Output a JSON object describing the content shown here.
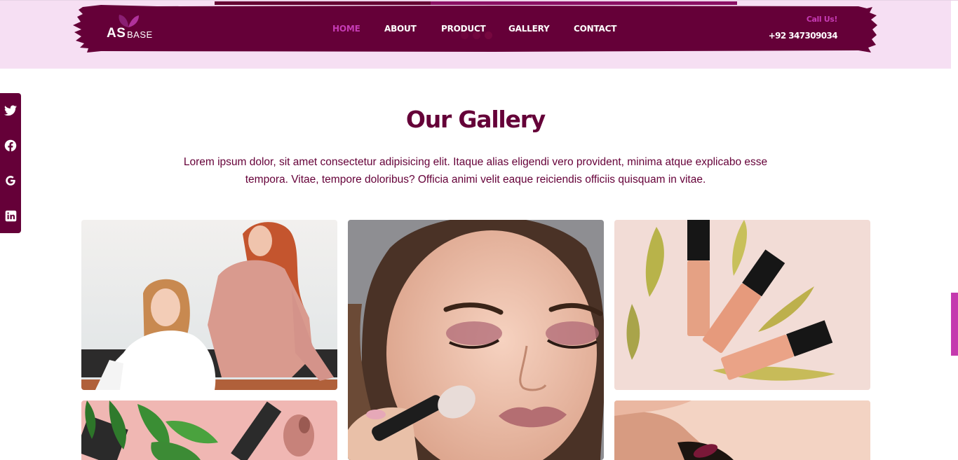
{
  "header": {
    "logo": {
      "primary": "AS",
      "secondary": "BASE"
    },
    "nav": [
      {
        "label": "HOME",
        "active": true
      },
      {
        "label": "ABOUT",
        "active": false
      },
      {
        "label": "PRODUCT",
        "active": false
      },
      {
        "label": "GALLERY",
        "active": false
      },
      {
        "label": "CONTACT",
        "active": false
      }
    ],
    "call_label": "Call Us!",
    "phone": "+92 347309034"
  },
  "social": [
    {
      "icon": "twitter-icon"
    },
    {
      "icon": "facebook-icon"
    },
    {
      "icon": "google-icon"
    },
    {
      "icon": "linkedin-icon"
    }
  ],
  "gallery": {
    "title": "Our Gallery",
    "description": "Lorem ipsum dolor, sit amet consectetur adipisicing elit. Itaque alias eligendi vero provident, minima atque explicabo esse tempora. Vitae, tempore doloribus? Officia animi velit eaque reiciendis officiis quisquam in vitae.",
    "images": [
      {
        "subject": "two-women-photo"
      },
      {
        "subject": "makeup-brush-portrait-photo"
      },
      {
        "subject": "lip-gloss-tubes-photo"
      },
      {
        "subject": "cosmetics-with-leaves-photo"
      },
      {
        "subject": "hand-with-nail-polish-photo"
      }
    ]
  },
  "colors": {
    "brand_dark": "#650038",
    "accent": "#c63bb4",
    "band": "#f6dff3"
  }
}
